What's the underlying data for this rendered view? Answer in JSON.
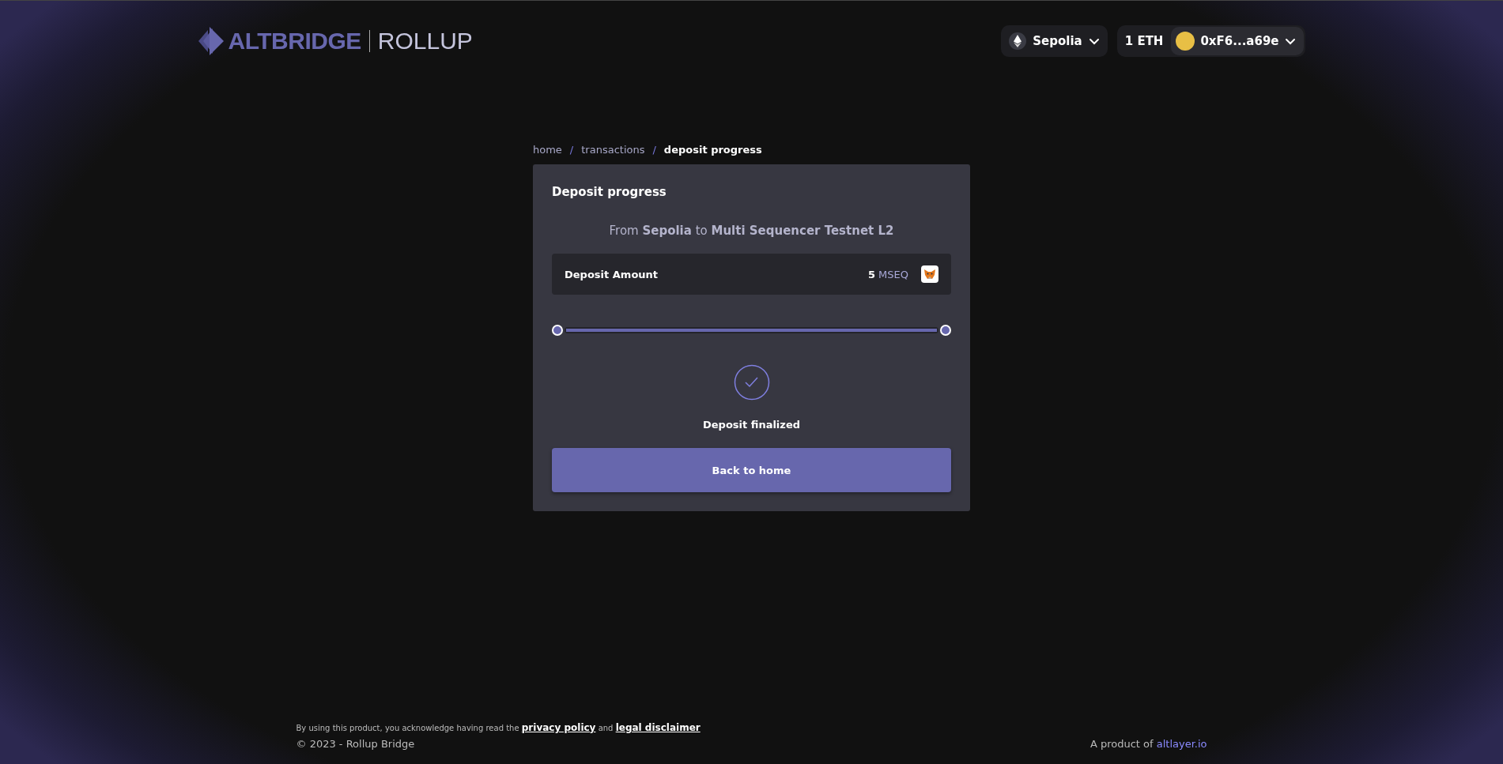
{
  "header": {
    "logo": {
      "brand": "ALTBRIDGE",
      "product": "ROLLUP"
    },
    "network": {
      "label": "Sepolia"
    },
    "balance": "1 ETH",
    "account": {
      "address": "0xF6...a69e"
    }
  },
  "breadcrumb": [
    {
      "label": "home",
      "current": false
    },
    {
      "label": "transactions",
      "current": false
    },
    {
      "label": "deposit progress",
      "current": true
    }
  ],
  "breadcrumb_separators": [
    "/",
    "/"
  ],
  "card": {
    "title": "Deposit progress",
    "route": "From **Sepolia** to **Multi Sequencer Testnet L2**",
    "amount": {
      "label": "Deposit Amount",
      "value": "5",
      "token": "MSEQ"
    },
    "progress": {
      "level": 1
    },
    "status": {
      "kind": "finalized",
      "label": "Deposit finalized"
    },
    "button": "Back to home"
  },
  "footer": {
    "notice": [
      {
        "kind": "text",
        "text": "By using this product, you acknowledge having read the"
      },
      {
        "kind": "link",
        "text": "privacy policy"
      },
      {
        "kind": "text",
        "text": "and"
      },
      {
        "kind": "link",
        "text": "legal disclaimer"
      }
    ],
    "copyright": "© 2023 - Rollup Bridge",
    "credit": "A product of",
    "credit_link": "altlayer.io"
  }
}
